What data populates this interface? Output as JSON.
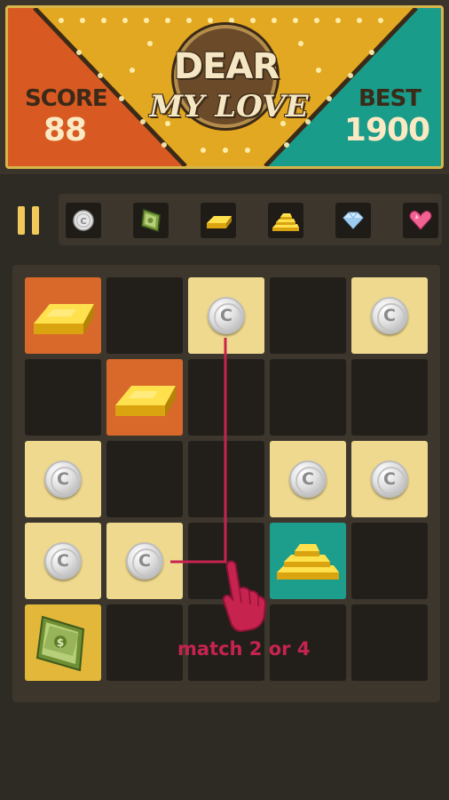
{
  "header": {
    "score_label": "SCORE",
    "score_value": "88",
    "best_label": "BEST",
    "best_value": "1900",
    "logo_title": "DEAR",
    "logo_subtitle": "MY LOVE",
    "colors": {
      "left_panel": "#d85a22",
      "right_panel": "#1a9c8a",
      "center": "#e3a821"
    }
  },
  "toolbar": {
    "pause_icon": "pause-icon",
    "legend_items": [
      "coin-icon",
      "money-icon",
      "gold-bar-icon",
      "gold-stack-icon",
      "diamond-icon",
      "heart-gem-icon"
    ]
  },
  "board": {
    "rows": 5,
    "cols": 5,
    "cells": [
      [
        "gold-bar",
        "empty",
        "coin",
        "empty",
        "coin"
      ],
      [
        "empty",
        "gold-bar",
        "empty",
        "empty",
        "empty"
      ],
      [
        "coin",
        "empty",
        "empty",
        "coin",
        "coin"
      ],
      [
        "coin",
        "coin",
        "empty",
        "gold-stack",
        "empty"
      ],
      [
        "money",
        "empty",
        "empty",
        "empty",
        "empty"
      ]
    ],
    "coin_letter": "C"
  },
  "tutorial": {
    "hint": "match 2 or 4",
    "hand_icon": "pointing-hand-icon",
    "color": "#c7234f"
  }
}
